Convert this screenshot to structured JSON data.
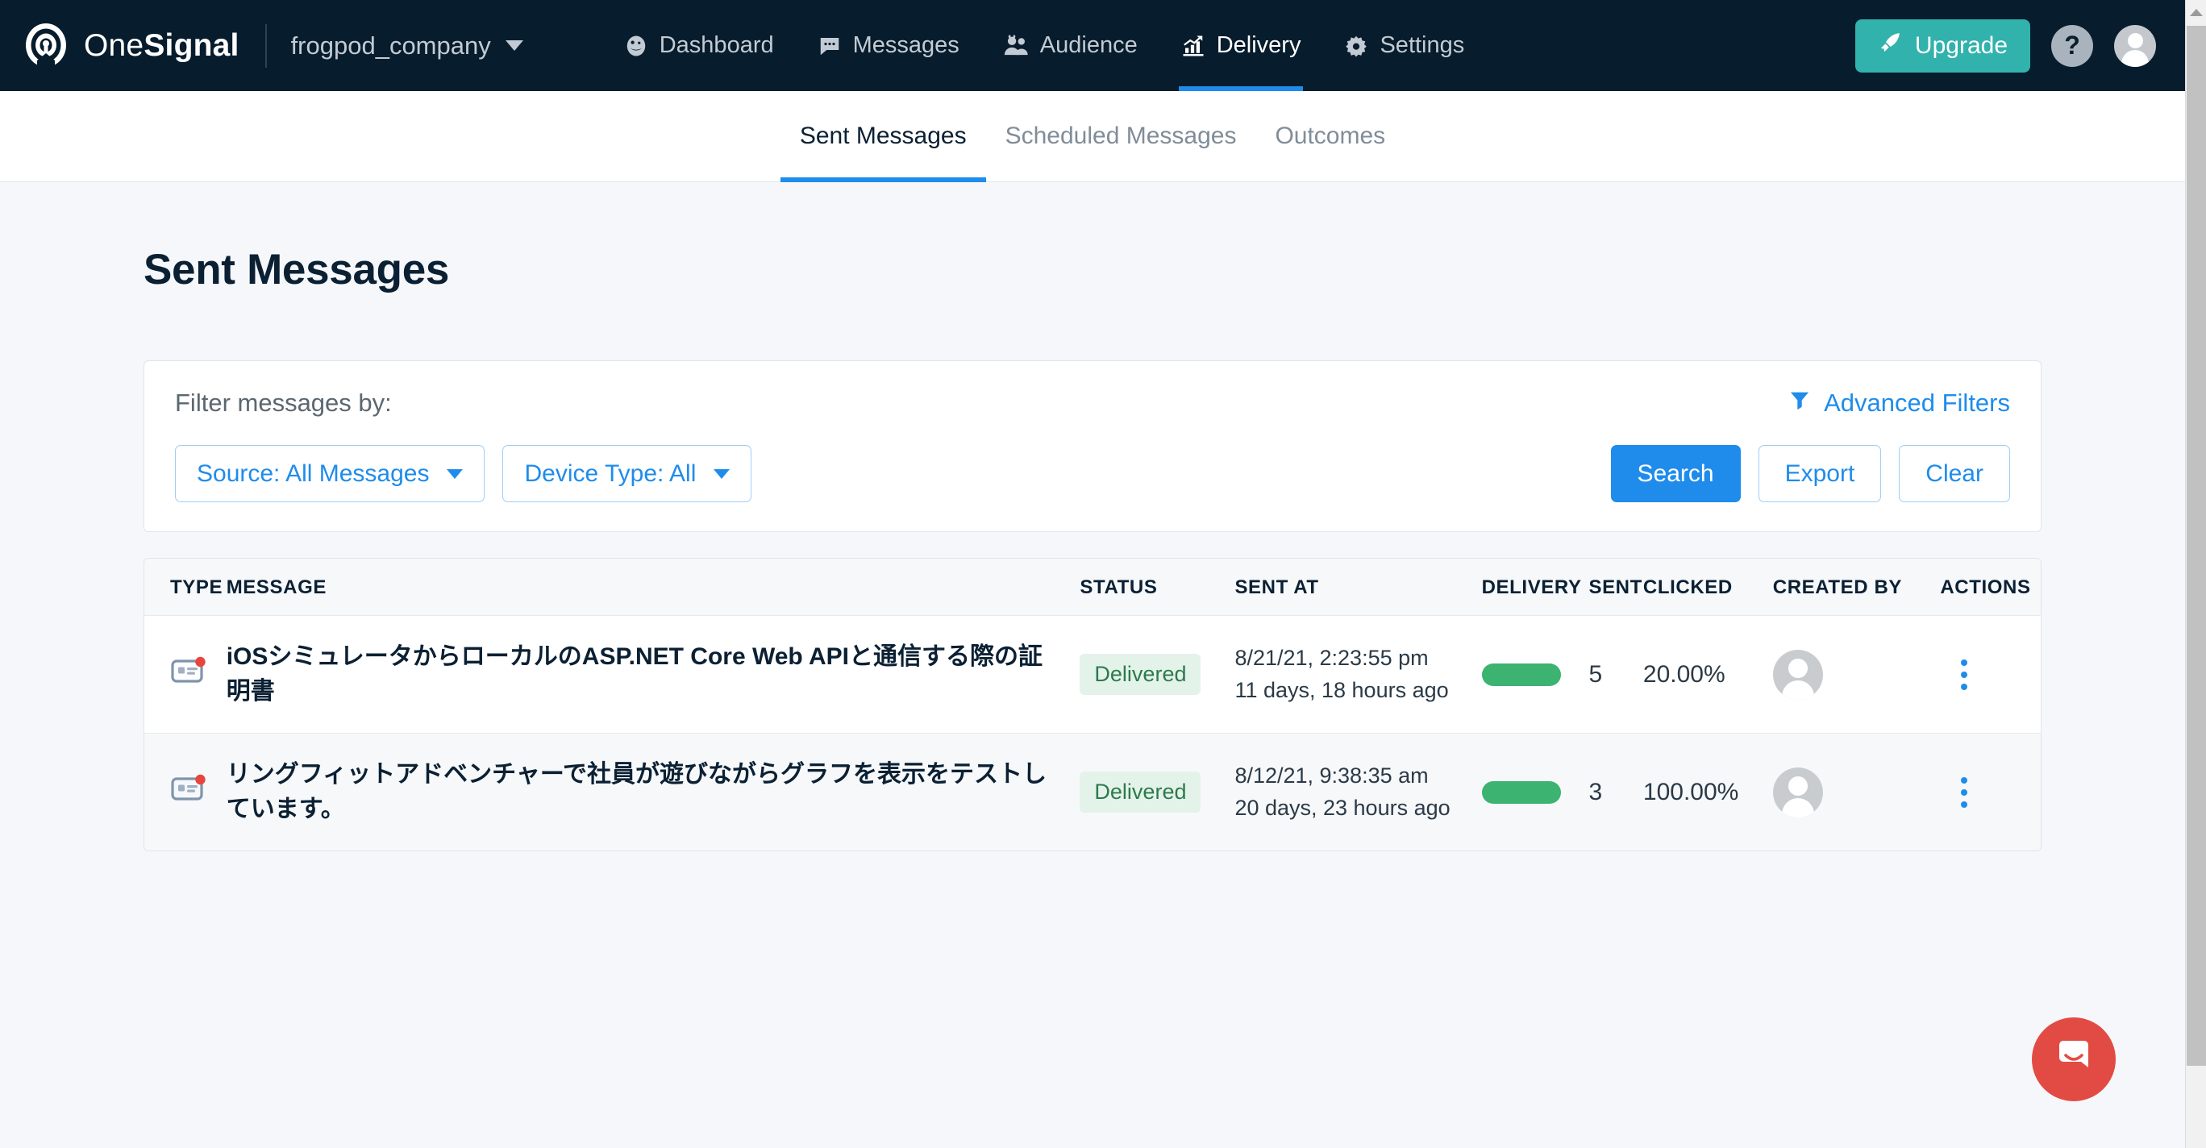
{
  "topnav": {
    "brand_one": "One",
    "brand_signal": "Signal",
    "app_name": "frogpod_company",
    "items": [
      {
        "label": "Dashboard",
        "icon": "dashboard-gauge-icon",
        "active": false
      },
      {
        "label": "Messages",
        "icon": "chat-bubble-icon",
        "active": false
      },
      {
        "label": "Audience",
        "icon": "people-icon",
        "active": false
      },
      {
        "label": "Delivery",
        "icon": "bar-chart-growth-icon",
        "active": true
      },
      {
        "label": "Settings",
        "icon": "gear-icon",
        "active": false
      }
    ],
    "upgrade_label": "Upgrade",
    "help_label": "?",
    "accent_blue": "#1f8ceb",
    "teal": "#31b2ad",
    "navbar_bg": "#071c2c"
  },
  "subnav": {
    "tabs": [
      {
        "label": "Sent Messages",
        "active": true
      },
      {
        "label": "Scheduled Messages",
        "active": false
      },
      {
        "label": "Outcomes",
        "active": false
      }
    ]
  },
  "page": {
    "title": "Sent Messages"
  },
  "filters": {
    "label": "Filter messages by:",
    "advanced_label": "Advanced Filters",
    "selects": [
      {
        "label": "Source: All Messages"
      },
      {
        "label": "Device Type: All"
      }
    ],
    "buttons": {
      "search": "Search",
      "export": "Export",
      "clear": "Clear"
    }
  },
  "table": {
    "columns": [
      "TYPE",
      "MESSAGE",
      "STATUS",
      "SENT AT",
      "DELIVERY",
      "SENT",
      "CLICKED",
      "CREATED BY",
      "ACTIONS"
    ],
    "rows": [
      {
        "type_icon": "web-push-notification-icon",
        "message": "iOSシミュレータからローカルのASP.NET Core Web APIと通信する際の証明書",
        "status": "Delivered",
        "sent_at": "8/21/21, 2:23:55 pm",
        "sent_ago": "11 days, 18 hours ago",
        "delivery_pct": 100,
        "sent": "5",
        "clicked": "20.00%",
        "created_by": "avatar"
      },
      {
        "type_icon": "web-push-notification-icon",
        "message": "リングフィットアドベンチャーで社員が遊びながらグラフを表示をテストしています。",
        "status": "Delivered",
        "sent_at": "8/12/21, 9:38:35 am",
        "sent_ago": "20 days, 23 hours ago",
        "delivery_pct": 100,
        "sent": "3",
        "clicked": "100.00%",
        "created_by": "avatar"
      }
    ],
    "status_color": "#2d7a4d",
    "status_bg": "#e4f3ea",
    "delivery_bar_color": "#3cb371"
  },
  "intercom": {
    "icon": "intercom-chat-icon",
    "color": "#e24b43"
  }
}
